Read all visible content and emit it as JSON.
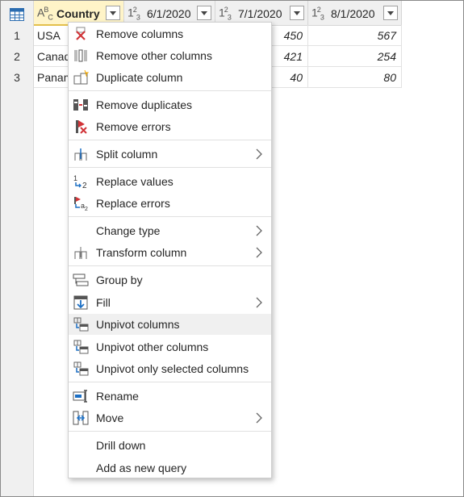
{
  "columns": [
    {
      "type_icon": "text-type-icon",
      "type_text": "ABC",
      "name": "Country"
    },
    {
      "type_icon": "number-type-icon",
      "type_text": "123",
      "name": "6/1/2020"
    },
    {
      "type_icon": "number-type-icon",
      "type_text": "123",
      "name": "7/1/2020"
    },
    {
      "type_icon": "number-type-icon",
      "type_text": "123",
      "name": "8/1/2020"
    }
  ],
  "rows": [
    {
      "num": "1",
      "country": "USA",
      "c7": "450",
      "c8": "567"
    },
    {
      "num": "2",
      "country": "Canad",
      "c7": "421",
      "c8": "254"
    },
    {
      "num": "3",
      "country": "Panam",
      "c7": "40",
      "c8": "80"
    }
  ],
  "menu": {
    "items": [
      {
        "label": "Remove columns",
        "icon": "remove-columns-icon"
      },
      {
        "label": "Remove other columns",
        "icon": "remove-other-columns-icon"
      },
      {
        "label": "Duplicate column",
        "icon": "duplicate-column-icon"
      },
      {
        "label": "Remove duplicates",
        "icon": "remove-duplicates-icon"
      },
      {
        "label": "Remove errors",
        "icon": "remove-errors-icon"
      },
      {
        "label": "Split column",
        "icon": "split-column-icon"
      },
      {
        "label": "Replace values",
        "icon": "replace-values-icon"
      },
      {
        "label": "Replace errors",
        "icon": "replace-errors-icon"
      },
      {
        "label": "Change type",
        "icon": ""
      },
      {
        "label": "Transform column",
        "icon": "transform-column-icon"
      },
      {
        "label": "Group by",
        "icon": "group-by-icon"
      },
      {
        "label": "Fill",
        "icon": "fill-icon"
      },
      {
        "label": "Unpivot columns",
        "icon": "unpivot-columns-icon"
      },
      {
        "label": "Unpivot other columns",
        "icon": "unpivot-other-columns-icon"
      },
      {
        "label": "Unpivot only selected columns",
        "icon": "unpivot-selected-columns-icon"
      },
      {
        "label": "Rename",
        "icon": "rename-icon"
      },
      {
        "label": "Move",
        "icon": "move-icon"
      },
      {
        "label": "Drill down",
        "icon": ""
      },
      {
        "label": "Add as new query",
        "icon": ""
      }
    ],
    "highlighted": "Unpivot columns"
  },
  "colors": {
    "accent": "#1c6fc4",
    "error": "#d13438",
    "selected_header": "#fff4c8"
  }
}
